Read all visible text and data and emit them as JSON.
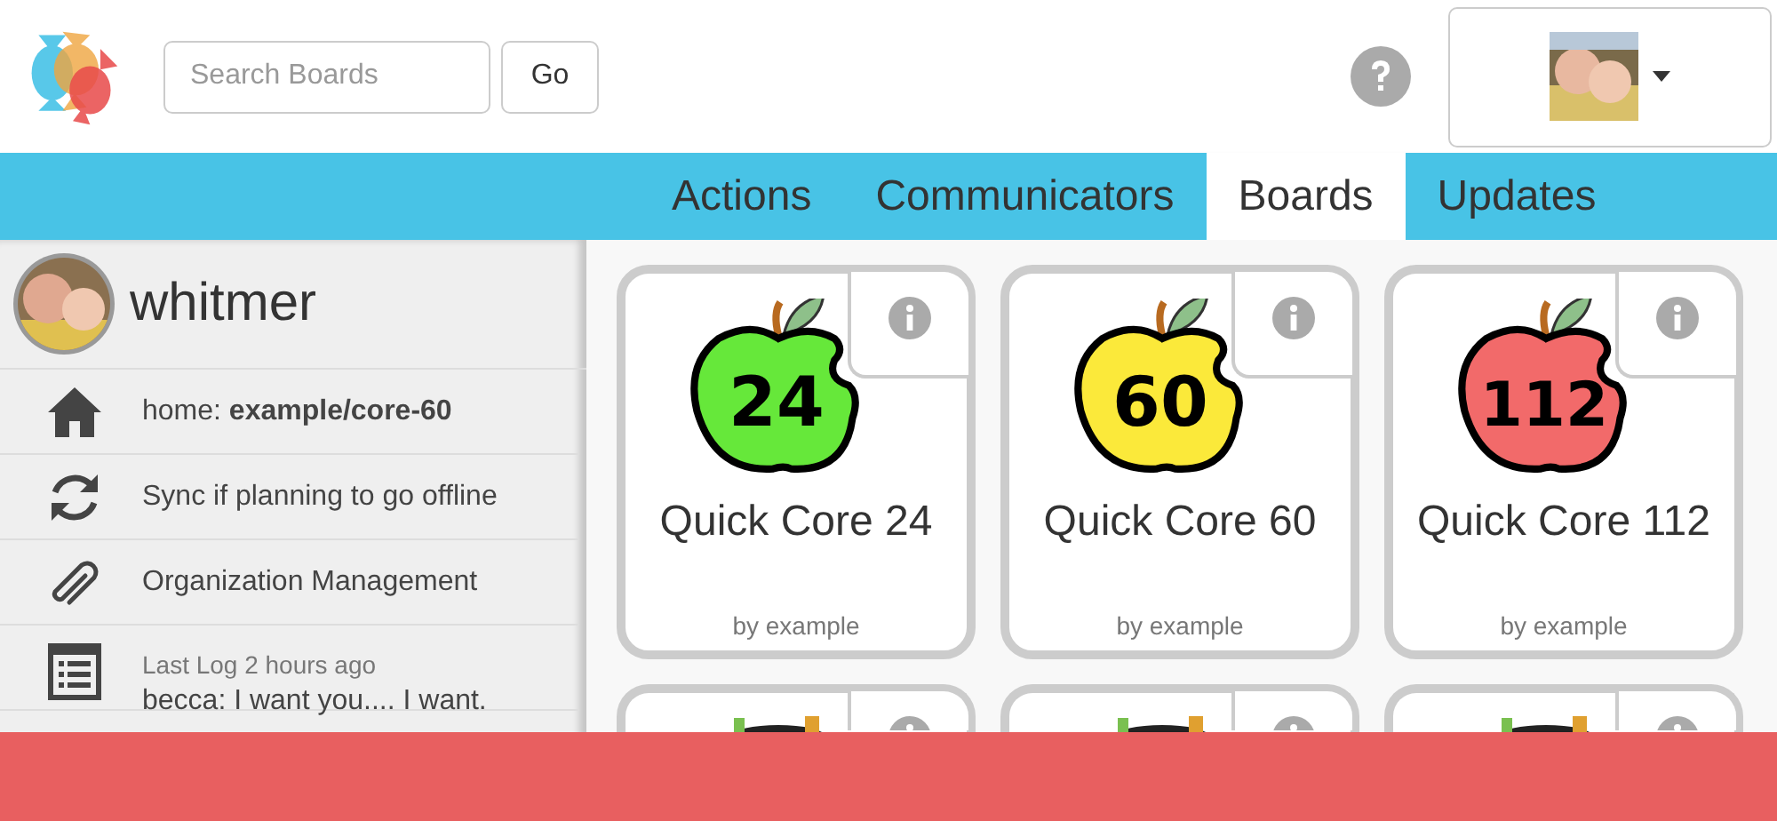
{
  "header": {
    "search": {
      "placeholder": "Search Boards"
    },
    "go_button": "Go"
  },
  "nav": {
    "tabs": [
      {
        "label": "Actions",
        "selected": false
      },
      {
        "label": "Communicators",
        "selected": false
      },
      {
        "label": "Boards",
        "selected": true
      },
      {
        "label": "Updates",
        "selected": false
      }
    ]
  },
  "sidebar": {
    "user_name": "whitmer",
    "items": [
      {
        "kind": "home",
        "text": "home: **example/core-60**"
      },
      {
        "kind": "sync",
        "text": "Sync if planning to go offline"
      },
      {
        "kind": "clip",
        "text": "Organization Management"
      },
      {
        "kind": "log",
        "caption": "Last Log 2 hours ago",
        "text": "becca: I want you.... I want."
      }
    ]
  },
  "boards": [
    {
      "number": "24",
      "color": "#66e83a",
      "title": "Quick Core 24",
      "author": "by example"
    },
    {
      "number": "60",
      "color": "#fbe93a",
      "title": "Quick Core 60",
      "author": "by example"
    },
    {
      "number": "112",
      "color": "#f26a6a",
      "title": "Quick Core 112",
      "author": "by example"
    },
    {
      "kind": "partial"
    },
    {
      "kind": "partial"
    },
    {
      "kind": "partial"
    }
  ]
}
